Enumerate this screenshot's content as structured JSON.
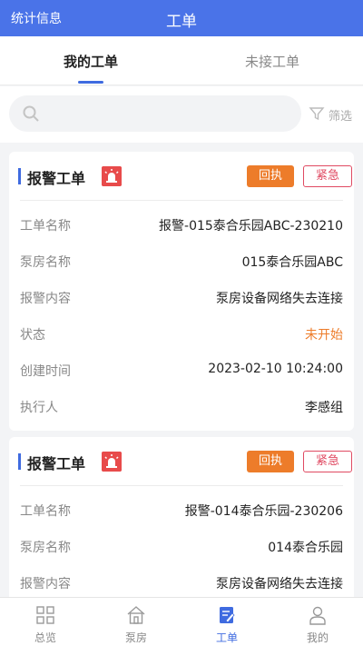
{
  "header": {
    "left_link": "统计信息",
    "title": "工单"
  },
  "tabs": [
    {
      "label": "我的工单",
      "active": true
    },
    {
      "label": "未接工单",
      "active": false
    }
  ],
  "search": {
    "placeholder": "",
    "filter_label": "筛选"
  },
  "cards": [
    {
      "title": "报警工单",
      "receipt_label": "回执",
      "urgent_label": "紧急",
      "fields": [
        {
          "label": "工单名称",
          "value": "报警-015泰合乐园ABC-230210"
        },
        {
          "label": "泵房名称",
          "value": "015泰合乐园ABC"
        },
        {
          "label": "报警内容",
          "value": "泵房设备网络失去连接"
        },
        {
          "label": "状态",
          "value": "未开始"
        },
        {
          "label": "创建时间",
          "value": "2023-02-10 10:24:00"
        },
        {
          "label": "执行人",
          "value": "李感组"
        }
      ]
    },
    {
      "title": "报警工单",
      "receipt_label": "回执",
      "urgent_label": "紧急",
      "fields": [
        {
          "label": "工单名称",
          "value": "报警-014泰合乐园-230206"
        },
        {
          "label": "泵房名称",
          "value": "014泰合乐园"
        },
        {
          "label": "报警内容",
          "value": "泵房设备网络失去连接"
        }
      ]
    }
  ],
  "nav": [
    {
      "label": "总览",
      "icon": "grid-icon",
      "active": false
    },
    {
      "label": "泵房",
      "icon": "house-icon",
      "active": false
    },
    {
      "label": "工单",
      "icon": "document-edit-icon",
      "active": true
    },
    {
      "label": "我的",
      "icon": "user-icon",
      "active": false
    }
  ],
  "colors": {
    "primary": "#4a73e8",
    "accent_orange": "#ed7c2a",
    "urgent_red": "#e04a62"
  }
}
